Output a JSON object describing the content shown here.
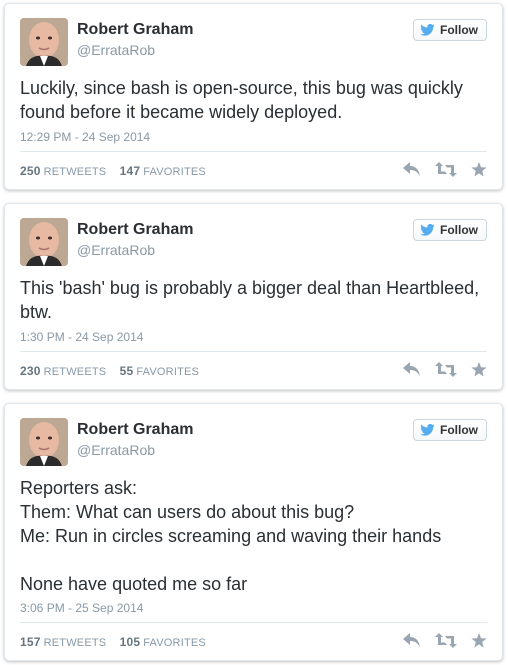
{
  "follow_label": "Follow",
  "tweets": [
    {
      "name": "Robert Graham",
      "handle": "@ErrataRob",
      "text": "Luckily, since bash is open-source, this bug was quickly found before it became widely deployed.",
      "timestamp": "12:29 PM - 24 Sep 2014",
      "retweets": "250",
      "retweets_label": "RETWEETS",
      "favorites": "147",
      "favorites_label": "FAVORITES"
    },
    {
      "name": "Robert Graham",
      "handle": "@ErrataRob",
      "text": "This 'bash' bug is probably a bigger deal than Heartbleed, btw.",
      "timestamp": "1:30 PM - 24 Sep 2014",
      "retweets": "230",
      "retweets_label": "RETWEETS",
      "favorites": "55",
      "favorites_label": "FAVORITES"
    },
    {
      "name": "Robert Graham",
      "handle": "@ErrataRob",
      "text": "Reporters ask:\nThem: What can users do about this bug?\nMe: Run in circles screaming and waving their hands\n\nNone have quoted me so far",
      "timestamp": "3:06 PM - 25 Sep 2014",
      "retweets": "157",
      "retweets_label": "RETWEETS",
      "favorites": "105",
      "favorites_label": "FAVORITES"
    }
  ],
  "icons": {
    "bird": "twitter-bird-icon",
    "reply": "reply-icon",
    "retweet": "retweet-icon",
    "favorite": "star-icon"
  },
  "colors": {
    "bird_blue": "#55acee",
    "muted": "#8899a6",
    "action_gray": "#99a5b0"
  }
}
